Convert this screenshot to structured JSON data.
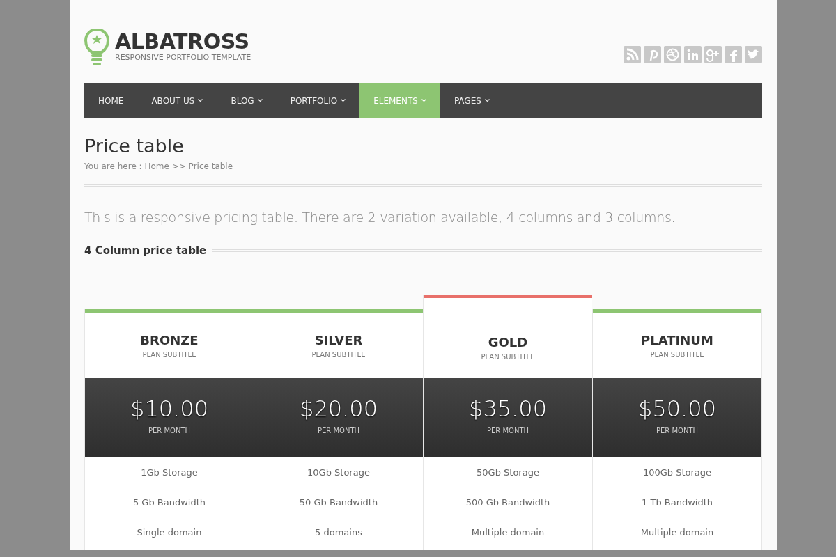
{
  "logo": {
    "title": "ALBATROSS",
    "tagline": "RESPONSIVE PORTFOLIO TEMPLATE"
  },
  "social": [
    {
      "kind": "rss"
    },
    {
      "kind": "pinterest"
    },
    {
      "kind": "dribbble"
    },
    {
      "kind": "linkedin"
    },
    {
      "kind": "googleplus"
    },
    {
      "kind": "facebook"
    },
    {
      "kind": "twitter"
    }
  ],
  "nav": [
    {
      "label": "HOME",
      "dropdown": false,
      "selected": false
    },
    {
      "label": "ABOUT US",
      "dropdown": true,
      "selected": false
    },
    {
      "label": "BLOG",
      "dropdown": true,
      "selected": false
    },
    {
      "label": "PORTFOLIO",
      "dropdown": true,
      "selected": false
    },
    {
      "label": "ELEMENTS",
      "dropdown": true,
      "selected": true
    },
    {
      "label": "PAGES",
      "dropdown": true,
      "selected": false
    }
  ],
  "page": {
    "title": "Price table",
    "breadcrumb": "You are here : Home >> Price table",
    "intro": "This is a responsive pricing table. There are 2 variation available, 4 columns and 3 columns.",
    "section_title": "4 Column price table"
  },
  "plans": [
    {
      "name": "BRONZE",
      "subtitle": "PLAN SUBTITLE",
      "price": "$10.00",
      "period": "PER MONTH",
      "color": "#8dc572",
      "featured": false,
      "features": [
        "1Gb Storage",
        "5 Gb Bandwidth",
        "Single domain"
      ]
    },
    {
      "name": "SILVER",
      "subtitle": "PLAN SUBTITLE",
      "price": "$20.00",
      "period": "PER MONTH",
      "color": "#8dc572",
      "featured": false,
      "features": [
        "10Gb Storage",
        "50 Gb Bandwidth",
        "5 domains"
      ]
    },
    {
      "name": "GOLD",
      "subtitle": "PLAN SUBTITLE",
      "price": "$35.00",
      "period": "PER MONTH",
      "color": "#e8706a",
      "featured": true,
      "features": [
        "50Gb Storage",
        "500 Gb Bandwidth",
        "Multiple domain"
      ]
    },
    {
      "name": "PLATINUM",
      "subtitle": "PLAN SUBTITLE",
      "price": "$50.00",
      "period": "PER MONTH",
      "color": "#8dc572",
      "featured": false,
      "features": [
        "100Gb Storage",
        "1 Tb Bandwidth",
        "Multiple domain"
      ]
    }
  ]
}
